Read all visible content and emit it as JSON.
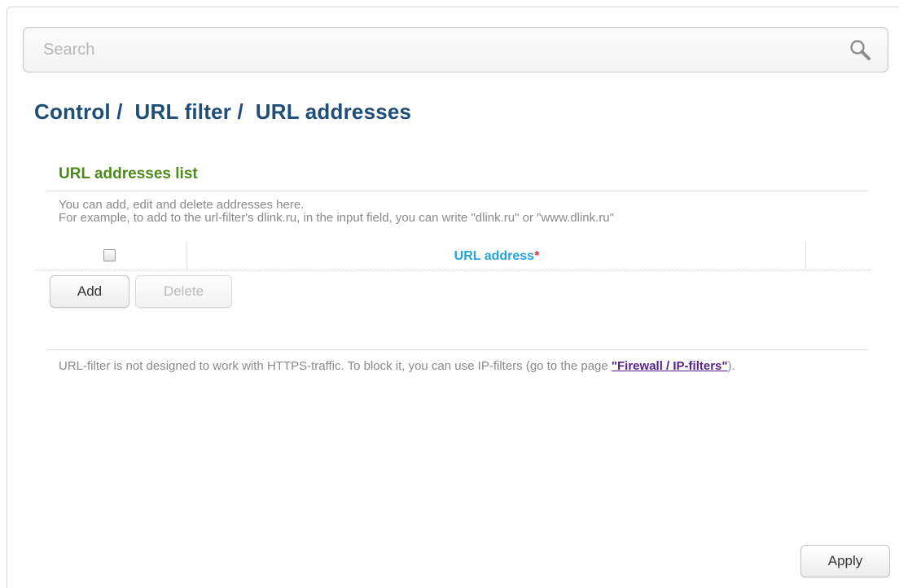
{
  "search": {
    "placeholder": "Search"
  },
  "breadcrumb": {
    "part1": "Control /",
    "part2": "URL filter /",
    "part3": "URL addresses"
  },
  "section": {
    "title": "URL addresses list",
    "description_line1": "You can add, edit and delete addresses here.",
    "description_line2": "For example, to add to the url-filter's dlink.ru, in the input field, you can write \"dlink.ru\" or \"www.dlink.ru\""
  },
  "table": {
    "columns": [
      {
        "label": "URL address",
        "required_mark": "*"
      }
    ],
    "select_all_checked": false
  },
  "buttons": {
    "add": "Add",
    "delete": "Delete",
    "apply": "Apply"
  },
  "note": {
    "text": "URL-filter is not designed to work with HTTPS-traffic. To block it, you can use IP-filters (go to the page ",
    "link_text": "\"Firewall / IP-filters\"",
    "suffix": ")."
  }
}
